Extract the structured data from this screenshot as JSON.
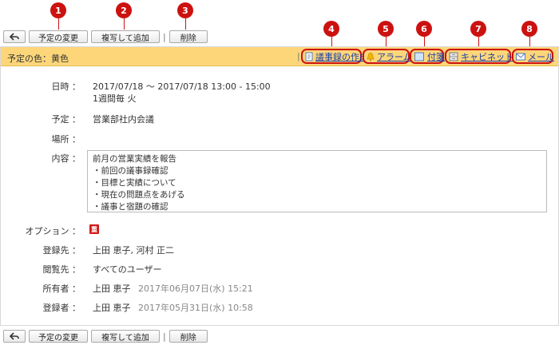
{
  "toolbar": {
    "back_label": "",
    "edit_label": "予定の変更",
    "copy_label": "複写して追加",
    "sep": "|",
    "delete_label": "削除"
  },
  "badges": [
    "1",
    "2",
    "3",
    "4",
    "5",
    "6",
    "7",
    "8"
  ],
  "colorbar": {
    "label": "予定の色：黄色",
    "sep": "|",
    "actions": {
      "minutes": "議事録の作成",
      "alarm": "アラーム",
      "sticky": "付箋",
      "cabinet": "キャビネット",
      "mail": "メール"
    }
  },
  "detail": {
    "datetime_label": "日時 ：",
    "datetime_value": "2017/07/18 ～ 2017/07/18 13:00 - 15:00",
    "repeat_value": "1週間毎 火",
    "title_label": "予定 ：",
    "title_value": "営業部社内会議",
    "place_label": "場所 ：",
    "content_label": "内容 ：",
    "content_lines": [
      "前月の営業実績を報告",
      "・前回の議事録確認",
      "・目標と実績について",
      "・現在の問題点をあげる",
      "・議事と宿題の確認"
    ],
    "option_label": "オプション ：",
    "option_icon": "重",
    "members_label": "登録先 ：",
    "members_value": "上田 恵子, 河村 正二",
    "viewers_label": "閲覧先 ：",
    "viewers_value": "すべてのユーザー",
    "owner_label": "所有者 ：",
    "owner_name": "上田 恵子",
    "owner_date": "2017年06月07日(水) 15:21",
    "creator_label": "登録者 ：",
    "creator_name": "上田 恵子",
    "creator_date": "2017年05月31日(水) 10:58"
  },
  "colors": {
    "accent_red": "#cc1111",
    "bar_yellow": "#fdd67a",
    "link_blue": "#1a3ea8"
  }
}
